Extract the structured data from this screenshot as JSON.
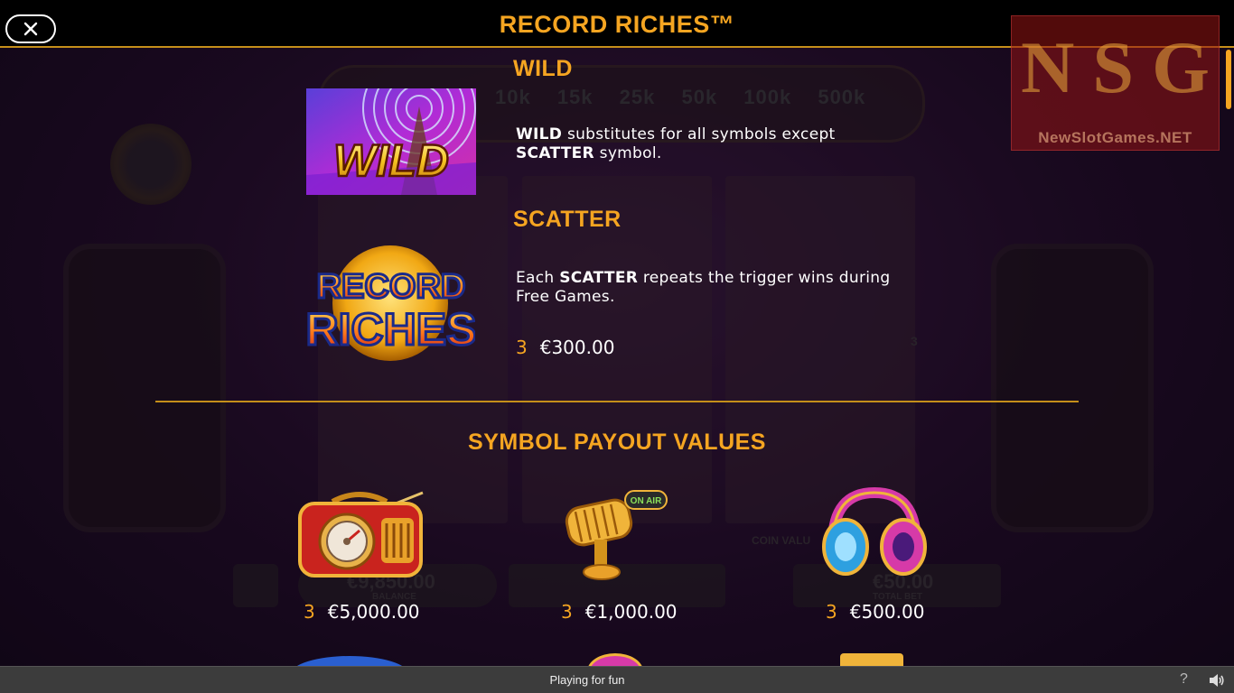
{
  "header": {
    "title": "RECORD RICHES™",
    "close_label": "close"
  },
  "watermark": {
    "letters": [
      "N",
      "S",
      "G"
    ],
    "text": "NewSlotGames.NET"
  },
  "background": {
    "multipliers": "10k 15k 25k 50k 100k 500k",
    "coin_value_label": "COIN VALU",
    "balance_value": "€9,850.00",
    "balance_label": "BALANCE",
    "total_bet_value": "€50.00",
    "total_bet_label": "TOTAL BET",
    "reel_counter": "3"
  },
  "wild": {
    "heading": "WILD",
    "symbol_text": "WILD",
    "desc_bold_1": "WILD",
    "desc_text_1": " substitutes for all symbols except",
    "desc_bold_2": "SCATTER",
    "desc_text_2": " symbol."
  },
  "scatter": {
    "heading": "SCATTER",
    "logo_line1": "RECORD",
    "logo_line2": "RICHES",
    "desc_text_1": "Each ",
    "desc_bold": "SCATTER",
    "desc_text_2": " repeats the trigger wins during",
    "desc_text_3": "Free Games.",
    "pay_count": "3",
    "pay_value": "€300.00"
  },
  "payouts": {
    "heading": "SYMBOL PAYOUT VALUES",
    "items": [
      {
        "symbol": "radio",
        "count": "3",
        "value": "€5,000.00"
      },
      {
        "symbol": "microphone",
        "count": "3",
        "value": "€1,000.00",
        "badge": "ON AIR"
      },
      {
        "symbol": "headphones",
        "count": "3",
        "value": "€500.00"
      }
    ]
  },
  "footer": {
    "mode_text": "Playing for fun",
    "help_label": "?"
  },
  "colors": {
    "accent": "#f5a521",
    "header_bg": "#000000",
    "footer_bg": "#3c3c3c"
  }
}
